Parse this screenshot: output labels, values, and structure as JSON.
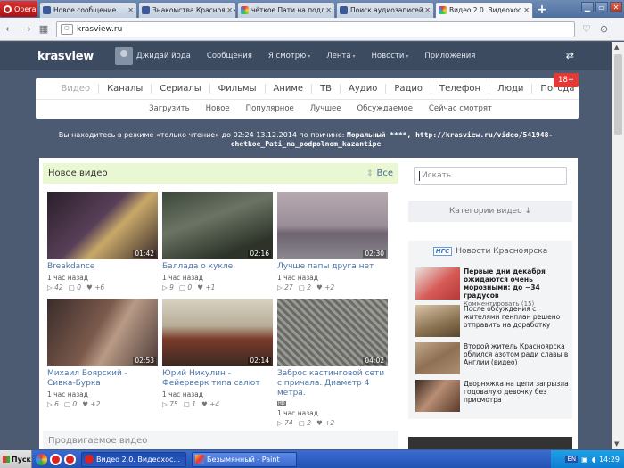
{
  "browser": {
    "menu_label": "Opera",
    "tabs": [
      {
        "label": "Новое сообщение",
        "color": "#3b5998",
        "active": false
      },
      {
        "label": "Знакомства Красноярск",
        "color": "#3b5998",
        "active": false
      },
      {
        "label": "чёткое Пати на подло...",
        "color": "#e05fa0",
        "active": false
      },
      {
        "label": "Поиск аудиозаписей",
        "color": "#3b5998",
        "active": false
      },
      {
        "label": "Видео 2.0. Видеохос...",
        "color": "#e05fa0",
        "active": true
      }
    ],
    "url": "krasview.ru"
  },
  "site": {
    "logo": "krasview",
    "user_name": "Джидай йода",
    "nav": [
      "Сообщения",
      "Я смотрю",
      "Лента",
      "Новости",
      "Приложения"
    ],
    "categories": [
      "Видео",
      "Каналы",
      "Сериалы",
      "Фильмы",
      "Аниме",
      "ТВ",
      "Аудио",
      "Радио",
      "Телефон",
      "Люди",
      "Погода"
    ],
    "age_badge": "18+",
    "subcategories": [
      "Загрузить",
      "Новое",
      "Популярное",
      "Лучшее",
      "Обсуждаемое",
      "Сейчас смотрят"
    ],
    "readonly_notice_plain": "Вы находитесь в режиме «только чтение» до 02:24 13.12.2014 по причине:",
    "readonly_notice_bold": "Моральный ****, http://krasview.ru/video/541948-",
    "readonly_notice_line2": "chetkoe_Pati_na_podpolnom_kazantipe"
  },
  "main": {
    "new_video_title": "Новое видео",
    "all_link": "Все",
    "videos": [
      {
        "title": "Breakdance",
        "duration": "01:42",
        "time": "1 час назад",
        "views": "42",
        "comments": "0",
        "rating": "+6",
        "hd": false
      },
      {
        "title": "Баллада о кукле",
        "duration": "02:16",
        "time": "1 час назад",
        "views": "9",
        "comments": "0",
        "rating": "+1",
        "hd": false
      },
      {
        "title": "Лучше папы друга нет",
        "duration": "02:30",
        "time": "1 час назад",
        "views": "27",
        "comments": "2",
        "rating": "+2",
        "hd": false
      },
      {
        "title": "Михаил Боярский - Сивка-Бурка",
        "duration": "02:53",
        "time": "1 час назад",
        "views": "6",
        "comments": "0",
        "rating": "+2",
        "hd": false
      },
      {
        "title": "Юрий Никулин - Фейерверк типа салют",
        "duration": "02:14",
        "time": "1 час назад",
        "views": "75",
        "comments": "1",
        "rating": "+4",
        "hd": false
      },
      {
        "title": "Заброс кастинговой сети с причала. Диаметр 4 метра.",
        "duration": "04:02",
        "time": "1 час назад",
        "views": "74",
        "comments": "2",
        "rating": "+2",
        "hd": true
      }
    ],
    "promo_title": "Продвигаемое видео"
  },
  "sidebar": {
    "search_placeholder": "Искать",
    "categories_label": "Категории видео",
    "news_logo": "НГС",
    "news_title": "Новости Красноярска",
    "news": [
      {
        "text": "Первые дни декабря ожидаются очень морозными: до −34 градусов",
        "bold": true,
        "comment": "Комментировать (15)"
      },
      {
        "text": "После обсуждения с жителями генплан решено отправить на доработку",
        "bold": false,
        "comment": ""
      },
      {
        "text": "Второй житель Красноярска облился азотом ради славы в Англии (видео)",
        "bold": false,
        "comment": ""
      },
      {
        "text": "Дворняжка на цепи загрызла годовалую девочку без присмотра",
        "bold": false,
        "comment": ""
      }
    ]
  },
  "taskbar": {
    "start": "Пуск",
    "windows": [
      {
        "label": "Видео 2.0. Видеохос...",
        "active": true
      },
      {
        "label": "Безымянный - Paint",
        "active": false
      }
    ],
    "lang": "EN",
    "clock": "14:29"
  }
}
